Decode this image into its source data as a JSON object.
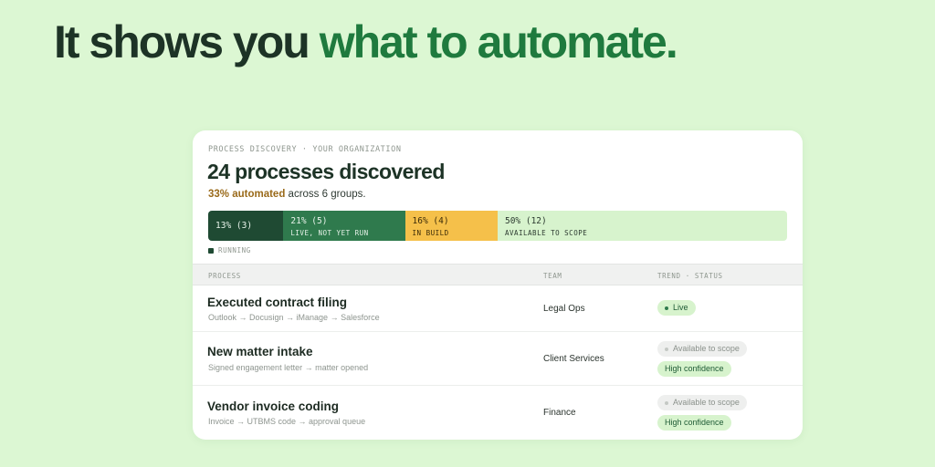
{
  "headline": {
    "part1": "It shows you ",
    "part2": "what to automate."
  },
  "card": {
    "eyebrow": "PROCESS DISCOVERY · YOUR ORGANIZATION",
    "title": "24 processes discovered",
    "subtitle_pct": "33% automated",
    "subtitle_rest": " across 6 groups.",
    "bar": [
      {
        "key": "running",
        "value": "13% (3)",
        "label": "",
        "percent": 13
      },
      {
        "key": "live",
        "value": "21% (5)",
        "label": "LIVE, NOT YET RUN",
        "percent": 21
      },
      {
        "key": "build",
        "value": "16% (4)",
        "label": "IN BUILD",
        "percent": 16
      },
      {
        "key": "scope",
        "value": "50% (12)",
        "label": "AVAILABLE TO SCOPE",
        "percent": 50
      }
    ],
    "legend_label": "RUNNING",
    "table_headers": {
      "process": "PROCESS",
      "team": "TEAM",
      "status": "TREND · STATUS"
    },
    "rows": [
      {
        "name": "Executed contract filing",
        "flow": "Outlook → Docusign → iManage → Salesforce",
        "team": "Legal Ops",
        "status": "Live",
        "confidence": ""
      },
      {
        "name": "New matter intake",
        "flow": "Signed engagement letter → matter opened",
        "team": "Client Services",
        "status": "Available to scope",
        "confidence": "High confidence"
      },
      {
        "name": "Vendor invoice coding",
        "flow": "Invoice → UTBMS code → approval queue",
        "team": "Finance",
        "status": "Available to scope",
        "confidence": "High confidence"
      }
    ]
  },
  "colors": {
    "background": "#dcf7d3",
    "accent": "#1f7a3e",
    "running": "#1f4a33",
    "live": "#2f7a4d",
    "build": "#f5c04a",
    "scope": "#d7f3cd"
  }
}
